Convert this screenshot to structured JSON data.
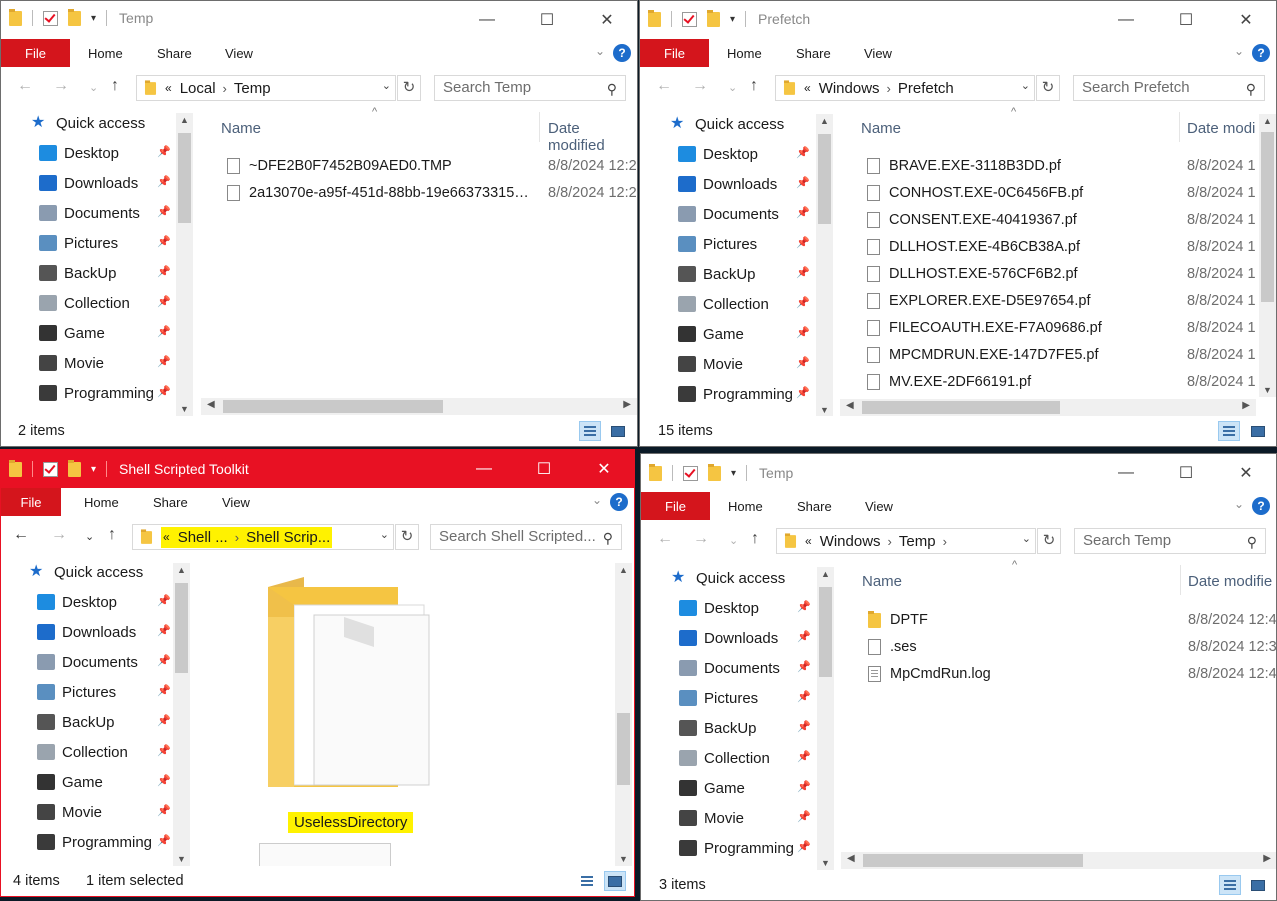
{
  "ribbon": {
    "file": "File",
    "home": "Home",
    "share": "Share",
    "view": "View",
    "help": "?"
  },
  "nav_items": [
    {
      "label": "Quick access",
      "icon": "star-icon",
      "color": "#1d6ccb"
    },
    {
      "label": "Desktop",
      "icon": "desktop-icon",
      "color": "#1d8ce0"
    },
    {
      "label": "Downloads",
      "icon": "download-icon",
      "color": "#1d6ccb"
    },
    {
      "label": "Documents",
      "icon": "documents-icon",
      "color": "#8a9bb0"
    },
    {
      "label": "Pictures",
      "icon": "pictures-icon",
      "color": "#5a8fc0"
    },
    {
      "label": "BackUp",
      "icon": "backup-icon",
      "color": "#555555"
    },
    {
      "label": "Collection",
      "icon": "collection-icon",
      "color": "#9aa4ae"
    },
    {
      "label": "Game",
      "icon": "game-icon",
      "color": "#333333"
    },
    {
      "label": "Movie",
      "icon": "movie-icon",
      "color": "#444444"
    },
    {
      "label": "Programming",
      "icon": "programming-icon",
      "color": "#3a3a3a"
    }
  ],
  "win1": {
    "title": "Temp",
    "breadcrumb": [
      "Local",
      "Temp"
    ],
    "search_placeholder": "Search Temp",
    "col_name": "Name",
    "col_date": "Date modified",
    "files": [
      {
        "name": "~DFE2B0F7452B09AED0.TMP",
        "date": "8/8/2024 12:2"
      },
      {
        "name": "2a13070e-a95f-451d-88bb-19e66373315…",
        "date": "8/8/2024 12:2"
      }
    ],
    "status_count": "2 items"
  },
  "win2": {
    "title": "Prefetch",
    "breadcrumb": [
      "Windows",
      "Prefetch"
    ],
    "search_placeholder": "Search Prefetch",
    "col_name": "Name",
    "col_date": "Date modi",
    "files": [
      {
        "name": "BRAVE.EXE-3118B3DD.pf",
        "date": "8/8/2024 1"
      },
      {
        "name": "CONHOST.EXE-0C6456FB.pf",
        "date": "8/8/2024 1"
      },
      {
        "name": "CONSENT.EXE-40419367.pf",
        "date": "8/8/2024 1"
      },
      {
        "name": "DLLHOST.EXE-4B6CB38A.pf",
        "date": "8/8/2024 1"
      },
      {
        "name": "DLLHOST.EXE-576CF6B2.pf",
        "date": "8/8/2024 1"
      },
      {
        "name": "EXPLORER.EXE-D5E97654.pf",
        "date": "8/8/2024 1"
      },
      {
        "name": "FILECOAUTH.EXE-F7A09686.pf",
        "date": "8/8/2024 1"
      },
      {
        "name": "MPCMDRUN.EXE-147D7FE5.pf",
        "date": "8/8/2024 1"
      },
      {
        "name": "MV.EXE-2DF66191.pf",
        "date": "8/8/2024 1"
      }
    ],
    "status_count": "15 items"
  },
  "win3": {
    "title": "Shell Scripted Toolkit",
    "breadcrumb": [
      "Shell ...",
      "Shell Scrip..."
    ],
    "search_placeholder": "Search Shell Scripted...",
    "folder_label": "UselessDirectory",
    "status_count": "4 items",
    "status_selected": "1 item selected",
    "accent": "#e81123",
    "highlight": "#fff200"
  },
  "win4": {
    "title": "Temp",
    "breadcrumb": [
      "Windows",
      "Temp"
    ],
    "search_placeholder": "Search Temp",
    "col_name": "Name",
    "col_date": "Date modifie",
    "files": [
      {
        "name": "DPTF",
        "date": "8/8/2024 12:4",
        "type": "folder"
      },
      {
        "name": ".ses",
        "date": "8/8/2024 12:3",
        "type": "file"
      },
      {
        "name": "MpCmdRun.log",
        "date": "8/8/2024 12:4",
        "type": "text"
      }
    ],
    "status_count": "3 items"
  }
}
